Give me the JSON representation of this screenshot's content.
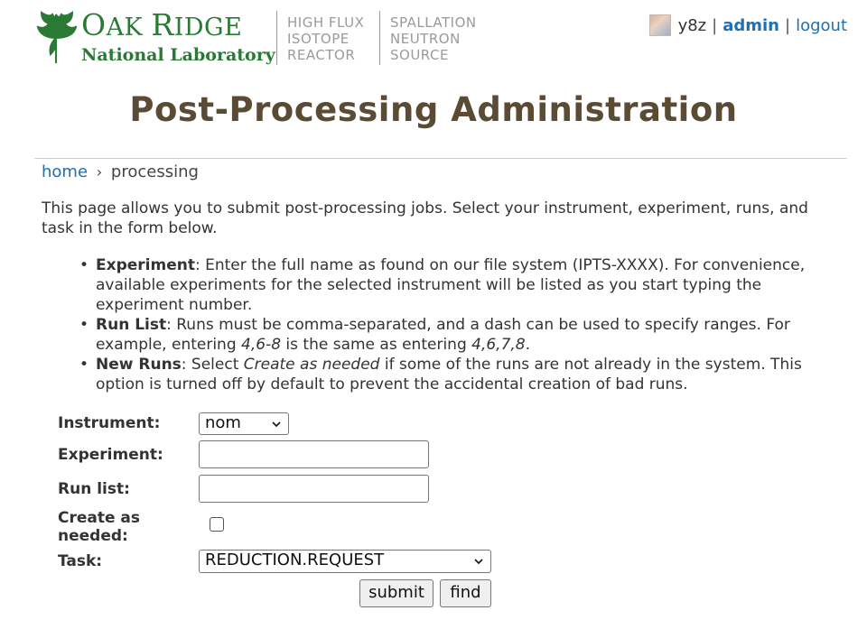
{
  "header": {
    "org_name_first": "O",
    "org_name_rest": "AK ",
    "org_name_r": "R",
    "org_name_idge": "IDGE",
    "org_subtitle": "National Laboratory",
    "facility_1": [
      "HIGH FLUX",
      "ISOTOPE",
      "REACTOR"
    ],
    "facility_2": [
      "SPALLATION",
      "NEUTRON",
      "SOURCE"
    ]
  },
  "user": {
    "username": "y8z",
    "admin_link": "admin",
    "logout_link": "logout",
    "separator": "|"
  },
  "page_title": "Post-Processing Administration",
  "breadcrumb": {
    "home": "home",
    "separator": "›",
    "current": "processing"
  },
  "intro": "This page allows you to submit post-processing jobs. Select your instrument, experiment, runs, and task in the form below.",
  "bullets": {
    "experiment_term": "Experiment",
    "experiment_text": ": Enter the full name as found on our file system (IPTS-XXXX). For convenience, available experiments for the selected instrument will be listed as you start typing the experiment number.",
    "runlist_term": "Run List",
    "runlist_text_1": ": Runs must be comma-separated, and a dash can be used to specify ranges. For example, entering ",
    "runlist_example_1": "4,6-8",
    "runlist_text_2": " is the same as entering ",
    "runlist_example_2": "4,6,7,8",
    "runlist_text_3": ".",
    "newruns_term": "New Runs",
    "newruns_text_1": ": Select ",
    "newruns_option": "Create as needed",
    "newruns_text_2": " if some of the runs are not already in the system. This option is turned off by default to prevent the accidental creation of bad runs."
  },
  "form": {
    "instrument_label": "Instrument:",
    "instrument_value": "nom",
    "experiment_label": "Experiment:",
    "experiment_value": "",
    "runlist_label": "Run list:",
    "runlist_value": "",
    "create_label_1": "Create as",
    "create_label_2": "needed:",
    "create_checked": false,
    "task_label": "Task:",
    "task_value": "REDUCTION.REQUEST",
    "submit_button": "submit",
    "find_button": "find"
  },
  "colors": {
    "brand_green": "#2a7a36",
    "title_brown": "#5b4a34",
    "link_blue": "#1f6fb2"
  }
}
